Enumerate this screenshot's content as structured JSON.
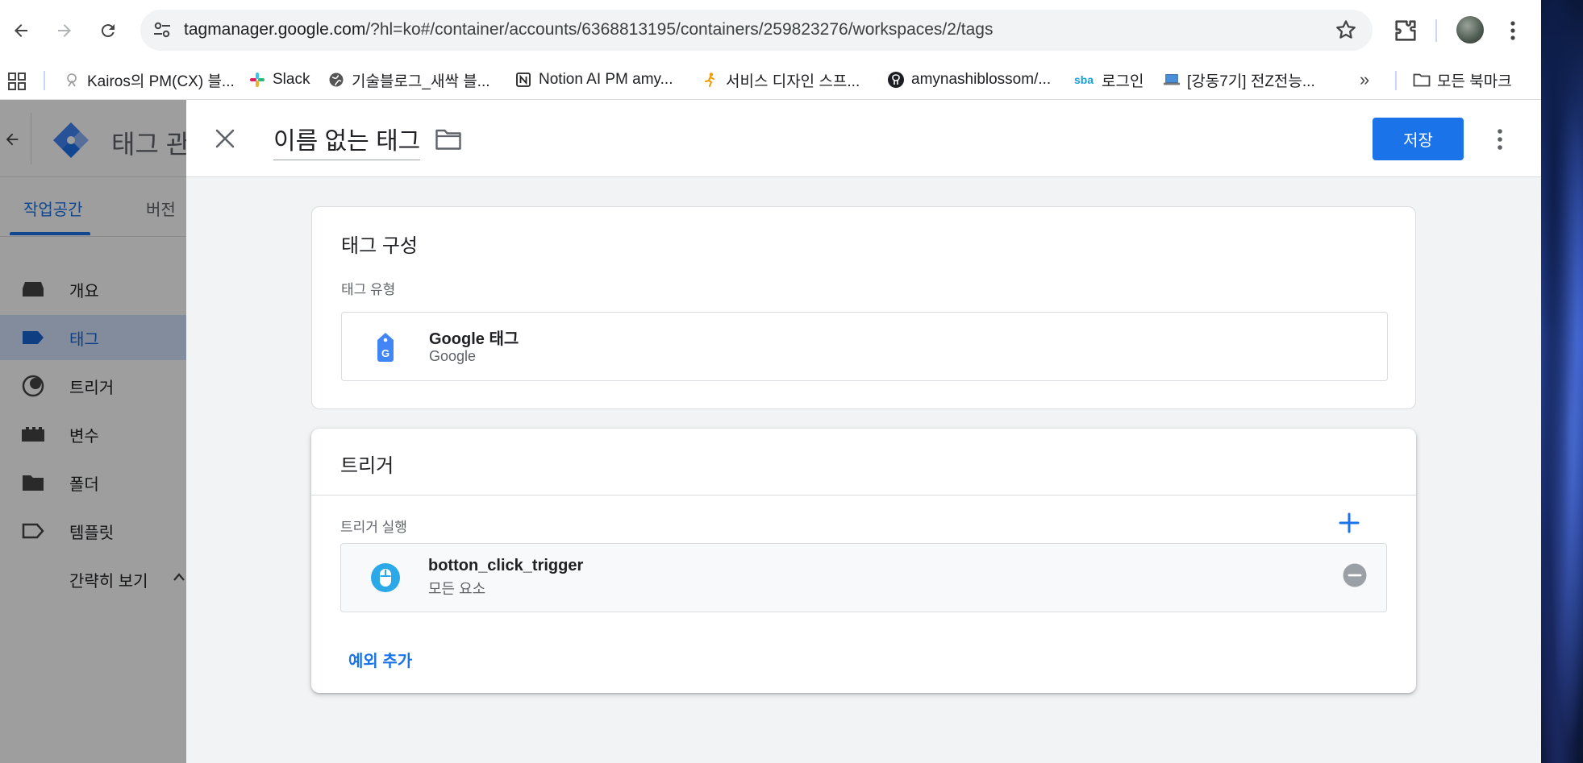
{
  "browser": {
    "url_host": "tagmanager.google.com",
    "url_path": "/?hl=ko#/container/accounts/6368813195/containers/259823276/workspaces/2/tags",
    "bookmarks": [
      {
        "label": "Kairos의 PM(CX) 블...",
        "icon": "kairos-icon"
      },
      {
        "label": "Slack",
        "icon": "slack-icon"
      },
      {
        "label": "기술블로그_새싹 블...",
        "icon": "globe-icon"
      },
      {
        "label": "Notion AI PM amy...",
        "icon": "notion-icon"
      },
      {
        "label": "서비스 디자인 스프...",
        "icon": "runner-icon"
      },
      {
        "label": "amynashiblossom/...",
        "icon": "github-icon"
      },
      {
        "label": "로그인",
        "icon": "sba-icon"
      },
      {
        "label": "[강동7기] 전Z전능...",
        "icon": "laptop-icon"
      }
    ],
    "bookmarks_more": "»",
    "all_bookmarks": "모든 북마크"
  },
  "app": {
    "title": "태그 관",
    "tabs": [
      {
        "label": "작업공간",
        "active": true
      },
      {
        "label": "버전",
        "active": false
      }
    ],
    "nav": [
      {
        "label": "개요",
        "icon": "overview-icon"
      },
      {
        "label": "태그",
        "icon": "tag-icon",
        "active": true
      },
      {
        "label": "트리거",
        "icon": "trigger-icon"
      },
      {
        "label": "변수",
        "icon": "variable-icon"
      },
      {
        "label": "폴더",
        "icon": "folder-icon"
      },
      {
        "label": "템플릿",
        "icon": "template-icon"
      }
    ],
    "collapse_label": "간략히 보기"
  },
  "editor": {
    "tag_name": "이름 없는 태그",
    "save_label": "저장",
    "config": {
      "title": "태그 구성",
      "type_label": "태그 유형",
      "type_name": "Google 태그",
      "type_vendor": "Google"
    },
    "triggers": {
      "title": "트리거",
      "firing_label": "트리거 실행",
      "items": [
        {
          "name": "botton_click_trigger",
          "detail": "모든 요소"
        }
      ],
      "add_exception": "예외 추가"
    }
  },
  "colors": {
    "accent": "#1a73e8",
    "trigger_icon": "#2aa8e8",
    "tag_icon": "#4285f4"
  }
}
